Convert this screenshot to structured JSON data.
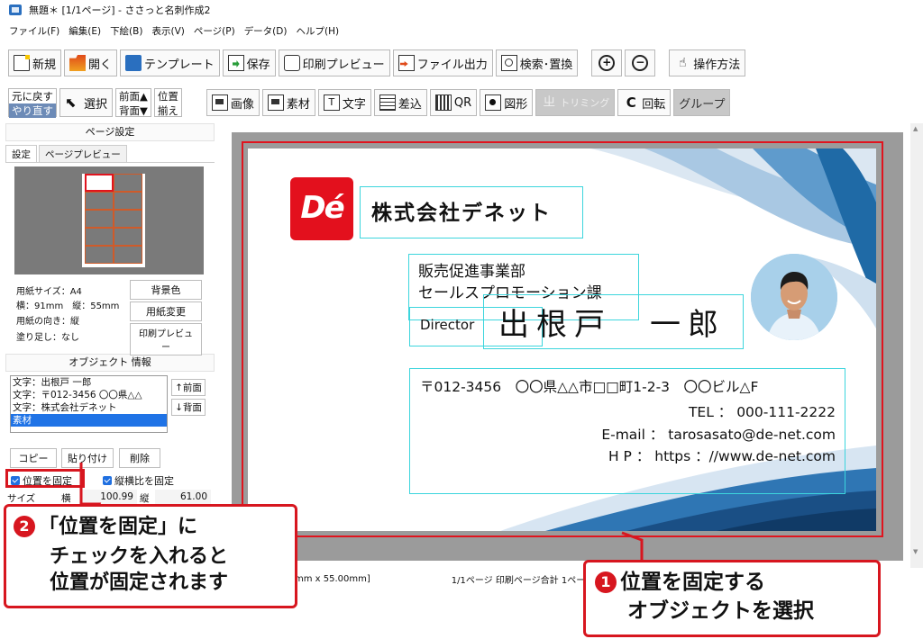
{
  "window": {
    "title": "無題＊ [1/1ページ] - ささっと名刺作成2"
  },
  "menu": [
    "ファイル(F)",
    "編集(E)",
    "下絵(B)",
    "表示(V)",
    "ページ(P)",
    "データ(D)",
    "ヘルプ(H)"
  ],
  "toolbar1": {
    "new": "新規",
    "open": "開く",
    "template": "テンプレート",
    "save": "保存",
    "print_preview": "印刷プレビュー",
    "export": "ファイル出力",
    "search_replace": "検索･置換",
    "zoom_in": "+",
    "zoom_out": "−",
    "howto": "操作方法"
  },
  "toolbar2": {
    "undo": "元に戻す",
    "redo": "やり直す",
    "select": "選択",
    "front": "前面▲",
    "back": "背面▼",
    "align1": "位置",
    "align2": "揃え",
    "image": "画像",
    "material": "素材",
    "text": "文字",
    "merge": "差込",
    "qr": "QR",
    "shape": "図形",
    "trim": "トリミング",
    "rotate": "回転",
    "group": "グループ",
    "text_icon": "T",
    "rotate_icon": "C",
    "trim_icon": "ㄓ"
  },
  "left": {
    "page_settings": "ページ設定",
    "tab_settings": "設定",
    "tab_preview": "ページプレビュー",
    "paper_size": "用紙サイズ：A4",
    "dimensions": "横：91mm　縦：55mm",
    "orientation": "用紙の向き：縦",
    "bleed": "塗り足し：なし",
    "bg_color": "背景色",
    "change_paper": "用紙変更",
    "print_preview": "印刷プレビュー",
    "object_info": "オブジェクト 情報",
    "objects": [
      "文字：出根戸 一郎",
      "文字：〒012-3456 〇〇県△△",
      "文字：株式会社デネット",
      "素材"
    ],
    "to_front": "↑前面",
    "to_back": "↓背面",
    "copy": "コピー",
    "paste": "貼り付け",
    "delete": "削除",
    "fix_position": "位置を固定",
    "fix_ratio": "縦横比を固定",
    "size_label": "サイズ",
    "width_label": "横",
    "width_value": "100.99",
    "height_label": "縦",
    "height_value": "61.00"
  },
  "card": {
    "company": "株式会社デネット",
    "logo": "Dé",
    "dept1": "販売促進事業部",
    "dept2": "セールスプロモーション課",
    "title": "Director",
    "name": "出根戸　一郎",
    "address": "〒012-3456　〇〇県△△市□□町1-2-3　〇〇ビル△F",
    "tel": "TEL ： 000-111-2222",
    "email": "E-mail ： tarosasato@de-net.com",
    "hp": "H P ： https ：//www.de-net.com"
  },
  "status": {
    "size": "mm x 55.00mm]",
    "pages": "1/1ページ 印刷ページ合計 1ページ"
  },
  "callouts": {
    "one_num": "1",
    "one_line1": "位置を固定する",
    "one_line2": "オブジェクトを選択",
    "two_num": "2",
    "two_line1": "「位置を固定」に",
    "two_line2": "チェックを入れると",
    "two_line3": "位置が固定されます"
  },
  "colors": {
    "accent_red": "#d7161f",
    "selection_cyan": "#3cd5dd",
    "wave_blue": "#1f5f9a",
    "logo_red": "#e3101d"
  }
}
